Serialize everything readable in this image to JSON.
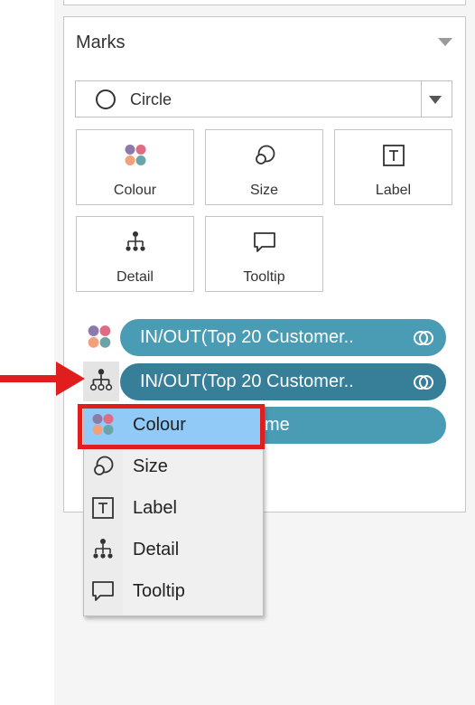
{
  "marks": {
    "title": "Marks",
    "mark_type": {
      "label": "Circle",
      "icon": "circle-icon"
    },
    "cards": [
      {
        "id": "colour",
        "label": "Colour",
        "icon": "colour-dots-icon"
      },
      {
        "id": "size",
        "label": "Size",
        "icon": "size-circles-icon"
      },
      {
        "id": "label",
        "label": "Label",
        "icon": "label-text-icon"
      },
      {
        "id": "detail",
        "label": "Detail",
        "icon": "detail-hierarchy-icon"
      },
      {
        "id": "tooltip",
        "label": "Tooltip",
        "icon": "tooltip-bubble-icon"
      }
    ],
    "shelf": [
      {
        "icon": "colour-dots-icon",
        "pill_text": "IN/OUT(Top 20 Customer..",
        "pill_icon": "set-link-icon"
      },
      {
        "icon": "detail-hierarchy-icon",
        "pill_text": "IN/OUT(Top 20 Customer..",
        "pill_icon": "set-link-icon"
      },
      {
        "icon": "",
        "pill_text": "me",
        "pill_icon": ""
      }
    ]
  },
  "context_menu": {
    "items": [
      {
        "label": "Colour",
        "icon": "colour-dots-icon",
        "selected": true
      },
      {
        "label": "Size",
        "icon": "size-circles-icon",
        "selected": false
      },
      {
        "label": "Label",
        "icon": "label-text-icon",
        "selected": false
      },
      {
        "label": "Detail",
        "icon": "detail-hierarchy-icon",
        "selected": false
      },
      {
        "label": "Tooltip",
        "icon": "tooltip-bubble-icon",
        "selected": false
      }
    ]
  },
  "colors": {
    "pill": "#4a9bb4",
    "pill_active": "#377f99",
    "menu_selected": "#91c9f7",
    "annotation_red": "#e01e1e",
    "dot_purple": "#8e7aa8",
    "dot_pink": "#e06c84",
    "dot_orange": "#f2a07a",
    "dot_teal": "#6aa3a8"
  }
}
